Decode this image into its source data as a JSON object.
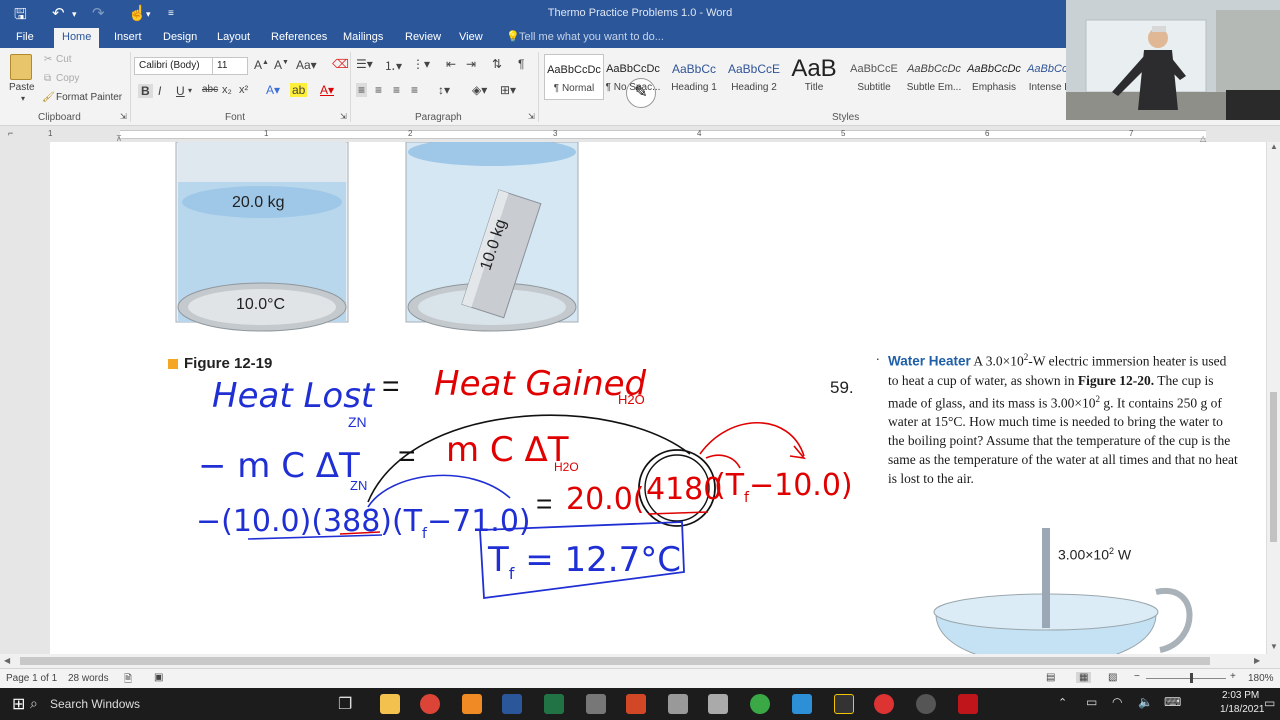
{
  "window": {
    "title": "Thermo Practice Problems 1.0 - Word"
  },
  "menu": {
    "tabs": [
      "File",
      "Home",
      "Insert",
      "Design",
      "Layout",
      "References",
      "Mailings",
      "Review",
      "View"
    ],
    "active": "Home",
    "tellme": "Tell me what you want to do..."
  },
  "ribbon": {
    "clipboard": {
      "paste": "Paste",
      "cut": "Cut",
      "copy": "Copy",
      "format_painter": "Format Painter",
      "label": "Clipboard"
    },
    "font": {
      "name": "Calibri (Body)",
      "size": "11",
      "label": "Font"
    },
    "paragraph": {
      "label": "Paragraph"
    },
    "styles": {
      "label": "Styles",
      "items": [
        {
          "preview": "AaBbCcDc",
          "name": "¶ Normal"
        },
        {
          "preview": "AaBbCcDc",
          "name": "¶ No Spac..."
        },
        {
          "preview": "AaBbCc",
          "name": "Heading 1"
        },
        {
          "preview": "AaBbCcE",
          "name": "Heading 2"
        },
        {
          "preview": "AaB",
          "name": "Title"
        },
        {
          "preview": "AaBbCcE",
          "name": "Subtitle"
        },
        {
          "preview": "AaBbCcDc",
          "name": "Subtle Em..."
        },
        {
          "preview": "AaBbCcDc",
          "name": "Emphasis"
        },
        {
          "preview": "AaBbCcDc",
          "name": "Intense E..."
        }
      ]
    }
  },
  "ruler": {
    "numbers": [
      "1",
      "1",
      "2",
      "3",
      "4",
      "5",
      "6",
      "7"
    ]
  },
  "figure": {
    "left_mass": "20.0 kg",
    "left_temp": "10.0°C",
    "right_mass": "10.0 kg",
    "caption": "Figure 12-19"
  },
  "handwriting": {
    "line1_left": "Heat Lost",
    "line1_left_sub": "ZN",
    "line1_eq": "=",
    "line1_right": "Heat Gained",
    "line1_right_sub": "H2O",
    "line2_left": "− m C ΔT",
    "line2_left_sub": "ZN",
    "line2_eq": "=",
    "line2_right": "m C ΔT",
    "line2_right_sub": "H2O",
    "line3_left": "−(10.0)(388)(T",
    "line3_left_tail": "−71.0)",
    "line3_eq": "=",
    "line3_right_a": "20.0(",
    "line3_circled": "4180",
    "line3_right_b": "(T",
    "line3_right_tail": "−10.0)",
    "answer": "T",
    "answer_rest": " = 12.7°C",
    "sub_f": "f"
  },
  "problem": {
    "number": "59.",
    "bullet": ".",
    "keyword": "Water Heater",
    "text_a": " A 3.0×10",
    "sup_a": "2",
    "text_b": "-W electric immersion heater is used to heat a cup of water, as shown in ",
    "fig_ref": "Figure 12-20.",
    "text_c": " The cup is made of glass, and its mass is 3.00×10",
    "sup_b": "2",
    "text_d": " g. It contains 250 g of water at 15°C. How much time is needed to bring the water to the boiling point? Assume that the temperature of the cup is the same as the temperature of the water at all times and that no heat is lost to the air.",
    "power_label": "3.00×10",
    "power_sup": "2",
    "power_unit": " W"
  },
  "status": {
    "page": "Page 1 of 1",
    "words": "28 words",
    "zoom": "180%"
  },
  "taskbar": {
    "search": "Search Windows",
    "time": "2:03 PM",
    "date": "1/18/2021"
  },
  "colors": {
    "word_blue": "#2b579a",
    "ink_blue": "#1f2fd4",
    "ink_red": "#e00000",
    "ink_black": "#111111"
  }
}
